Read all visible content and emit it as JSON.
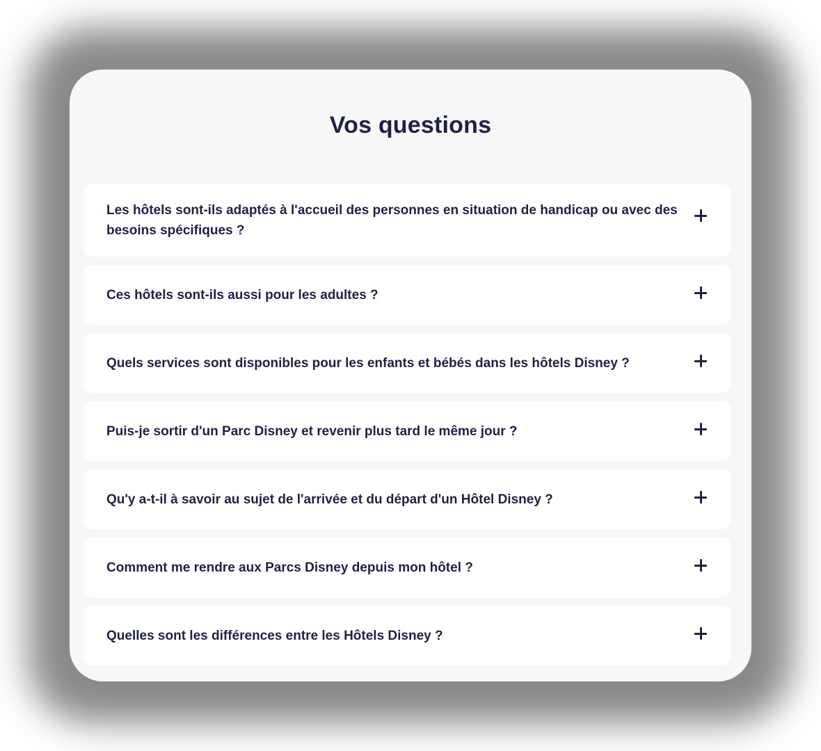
{
  "faq": {
    "title": "Vos questions",
    "items": [
      {
        "question": "Les hôtels sont-ils adaptés à l'accueil des personnes en situation de handicap ou avec des besoins spécifiques ?",
        "icon": "plus-icon"
      },
      {
        "question": "Ces hôtels sont-ils aussi pour les adultes ?",
        "icon": "plus-icon"
      },
      {
        "question": "Quels services sont disponibles pour les enfants et bébés dans les hôtels Disney ?",
        "icon": "plus-icon"
      },
      {
        "question": "Puis-je sortir d'un Parc Disney et revenir plus tard le même jour ?",
        "icon": "plus-icon"
      },
      {
        "question": "Qu'y a-t-il à savoir au sujet de l'arrivée et du départ d'un Hôtel Disney ?",
        "icon": "plus-icon"
      },
      {
        "question": "Comment me rendre aux Parcs Disney depuis mon hôtel ?",
        "icon": "plus-icon"
      },
      {
        "question": "Quelles sont les différences entre les Hôtels Disney ?",
        "icon": "plus-icon"
      }
    ]
  },
  "colors": {
    "card_background": "#f7f7f7",
    "item_background": "#ffffff",
    "text": "#1f2147"
  }
}
